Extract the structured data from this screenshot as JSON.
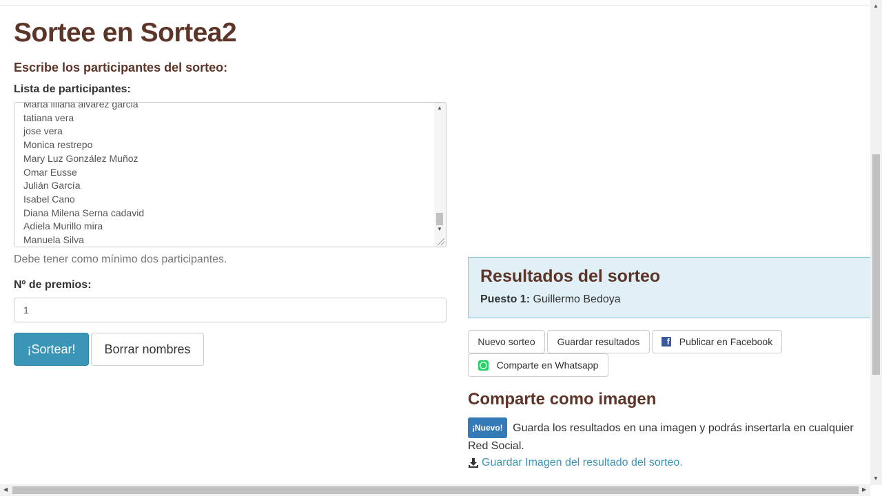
{
  "page": {
    "title": "Sortee en Sortea2",
    "subtitle": "Escribe los participantes del sorteo:"
  },
  "participants": {
    "label": "Lista de participantes:",
    "lines": [
      "Marta lillana alvarez garcia",
      "tatiana vera",
      "jose vera",
      "Monica restrepo",
      "Mary Luz González Muñoz",
      "Omar Eusse",
      "Julián García",
      "Isabel Cano",
      "Diana Milena Serna cadavid",
      "Adiela Murillo mira",
      "Manuela Silva"
    ],
    "help": "Debe tener como mínimo dos participantes."
  },
  "prizes": {
    "label": "Nº de premios:",
    "value": "1"
  },
  "actions": {
    "draw": "¡Sortear!",
    "clear": "Borrar nombres"
  },
  "results": {
    "title": "Resultados del sorteo",
    "position_label": "Puesto 1:",
    "winner": "Guillermo Bedoya"
  },
  "result_actions": {
    "new_draw": "Nuevo sorteo",
    "save_results": "Guardar resultados",
    "facebook": "Publicar en Facebook",
    "whatsapp": "Comparte en Whatsapp"
  },
  "share_image": {
    "title": "Comparte como imagen",
    "badge": "¡Nuevo!",
    "description": "Guarda los resultados en una imagen y podrás insertarla en cualquier Red Social.",
    "link": "Guardar Imagen del resultado del sorteo."
  },
  "icons": {
    "facebook": "facebook-icon",
    "whatsapp": "whatsapp-icon",
    "download": "download-icon"
  },
  "colors": {
    "heading": "#5d3428",
    "primary": "#3a95b6",
    "results_bg": "#e1f0f6",
    "badge": "#337ab7",
    "facebook": "#3b5998",
    "whatsapp": "#25d366"
  }
}
